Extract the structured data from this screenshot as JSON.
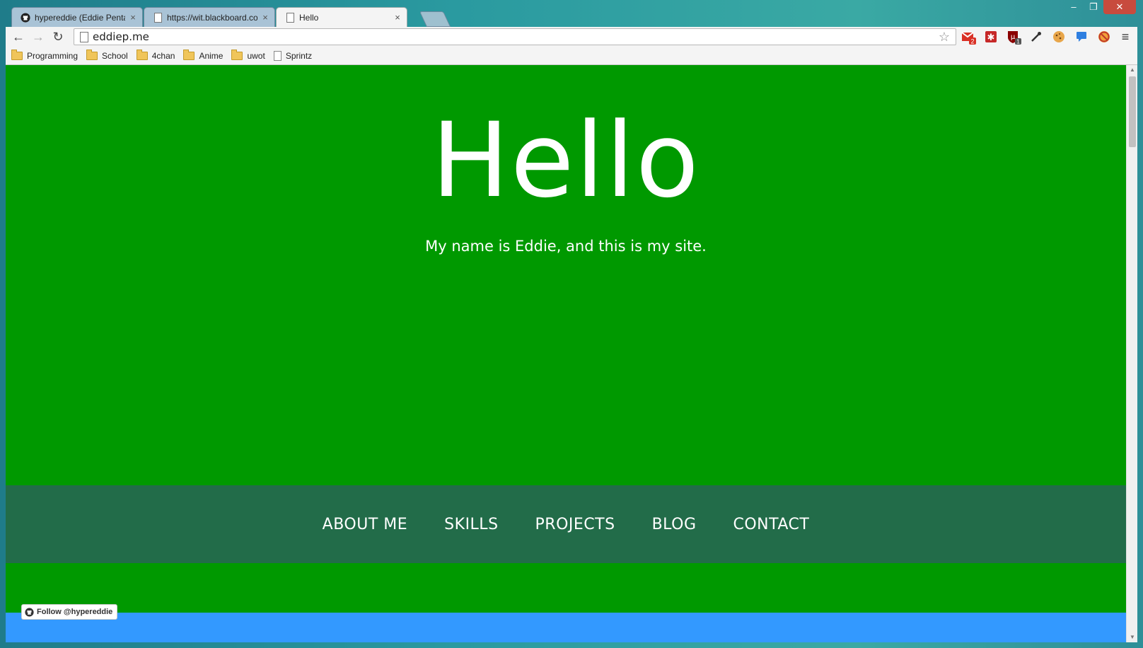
{
  "browser": {
    "tabs": [
      {
        "label": "hypereddie (Eddie Penta)",
        "icon": "github-icon"
      },
      {
        "label": "https://wit.blackboard.co",
        "icon": "page-icon"
      },
      {
        "label": "Hello",
        "icon": "page-icon"
      }
    ],
    "close_glyph": "×",
    "url": "eddiep.me",
    "extensions": {
      "gmail_badge": "2",
      "ublock_badge": "1"
    },
    "bookmarks": [
      {
        "label": "Programming",
        "icon": "folder-icon"
      },
      {
        "label": "School",
        "icon": "folder-icon"
      },
      {
        "label": "4chan",
        "icon": "folder-icon"
      },
      {
        "label": "Anime",
        "icon": "folder-icon"
      },
      {
        "label": "uwot",
        "icon": "folder-icon"
      },
      {
        "label": "Sprintz",
        "icon": "page-icon"
      }
    ]
  },
  "page": {
    "title": "Hello",
    "tagline": "My name is Eddie, and this is my site.",
    "nav": [
      "ABOUT ME",
      "SKILLS",
      "PROJECTS",
      "BLOG",
      "CONTACT"
    ],
    "follow_button": "Follow @hypereddie"
  },
  "colors": {
    "hero": "#009900",
    "navbar": "#226c49",
    "footer": "#3399ff"
  }
}
